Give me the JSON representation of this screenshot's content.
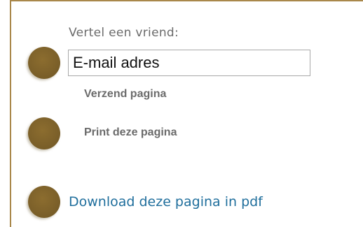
{
  "share": {
    "label": "Vertel een vriend:",
    "email_placeholder": "E-mail adres",
    "send_label": "Verzend pagina"
  },
  "print": {
    "label": "Print deze pagina"
  },
  "download": {
    "label": "Download deze pagina in pdf"
  },
  "colors": {
    "border": "#a9874a",
    "bullet": "#7d612a",
    "link": "#1f6e9c",
    "bold_text": "#6b6b6b"
  }
}
